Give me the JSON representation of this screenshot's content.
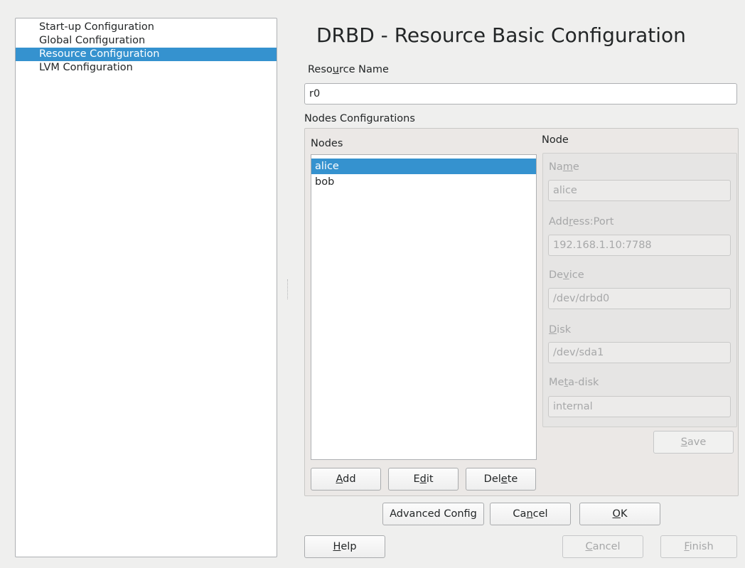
{
  "steps": [
    {
      "label": "Start-up Configuration",
      "selected": false
    },
    {
      "label": "Global Configuration",
      "selected": false
    },
    {
      "label": "Resource Configuration",
      "selected": true
    },
    {
      "label": "LVM Configuration",
      "selected": false
    }
  ],
  "title": "DRBD - Resource Basic Configuration",
  "resource_name": {
    "label_a": "Reso",
    "label_u": "u",
    "label_b": "rce Name",
    "value": "r0"
  },
  "nodes_config_label": "Nodes Configurations",
  "nodes": {
    "header": "Nodes",
    "items": [
      {
        "label": "alice",
        "selected": true
      },
      {
        "label": "bob",
        "selected": false
      }
    ]
  },
  "node": {
    "header": "Node",
    "name": {
      "label_a": "Na",
      "label_u": "m",
      "label_b": "e",
      "value": "alice"
    },
    "address": {
      "label_a": "Add",
      "label_u": "r",
      "label_b": "ess:Port",
      "value": "192.168.1.10:7788"
    },
    "device": {
      "label_a": "De",
      "label_u": "v",
      "label_b": "ice",
      "value": "/dev/drbd0"
    },
    "disk": {
      "label_a": "",
      "label_u": "D",
      "label_b": "isk",
      "value": "/dev/sda1"
    },
    "metadisk": {
      "label_a": "Me",
      "label_u": "t",
      "label_b": "a-disk",
      "value": "internal"
    },
    "save": {
      "a": "",
      "u": "S",
      "b": "ave"
    }
  },
  "list_buttons": {
    "add": {
      "a": "",
      "u": "A",
      "b": "dd"
    },
    "edit": {
      "a": "E",
      "u": "d",
      "b": "it"
    },
    "delete": {
      "a": "Del",
      "u": "e",
      "b": "te"
    }
  },
  "dialog_buttons": {
    "advanced": "Advanced Config",
    "cancel": {
      "a": "Ca",
      "u": "n",
      "b": "cel"
    },
    "ok": {
      "a": "",
      "u": "O",
      "b": "K"
    }
  },
  "wizard_buttons": {
    "help": {
      "a": "",
      "u": "H",
      "b": "elp"
    },
    "cancel": {
      "a": "",
      "u": "C",
      "b": "ancel"
    },
    "finish": {
      "a": "",
      "u": "F",
      "b": "inish"
    }
  }
}
